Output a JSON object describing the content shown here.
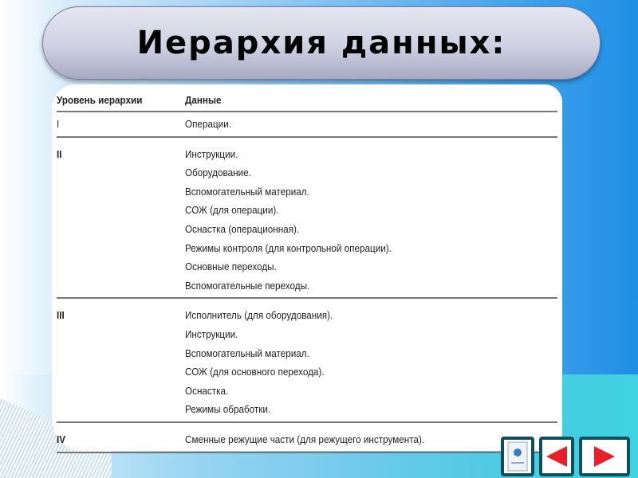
{
  "title": "Иерархия данных:",
  "table": {
    "headers": [
      "Уровень иерархии",
      "Данные"
    ],
    "rows": [
      {
        "level": "I",
        "items": [
          "Операции."
        ]
      },
      {
        "level": "II",
        "items": [
          "Инструкции.",
          "Оборудование.",
          "Вспомогательный материал.",
          "СОЖ (для операции).",
          "Оснастка (операционная).",
          "Режимы контроля (для контрольной операции).",
          "Основные переходы.",
          "Вспомогательные переходы."
        ]
      },
      {
        "level": "III",
        "items": [
          "Исполнитель (для оборудования).",
          "Инструкции.",
          "Вспомогательный материал.",
          "СОЖ (для основного перехода).",
          "Оснастка.",
          "Режимы обработки."
        ]
      },
      {
        "level": "IV",
        "items": [
          "Сменные режущие части (для режущего инструмента)."
        ]
      }
    ]
  },
  "nav": {
    "accent": "#e8202a",
    "border": "#0e4f5e"
  }
}
